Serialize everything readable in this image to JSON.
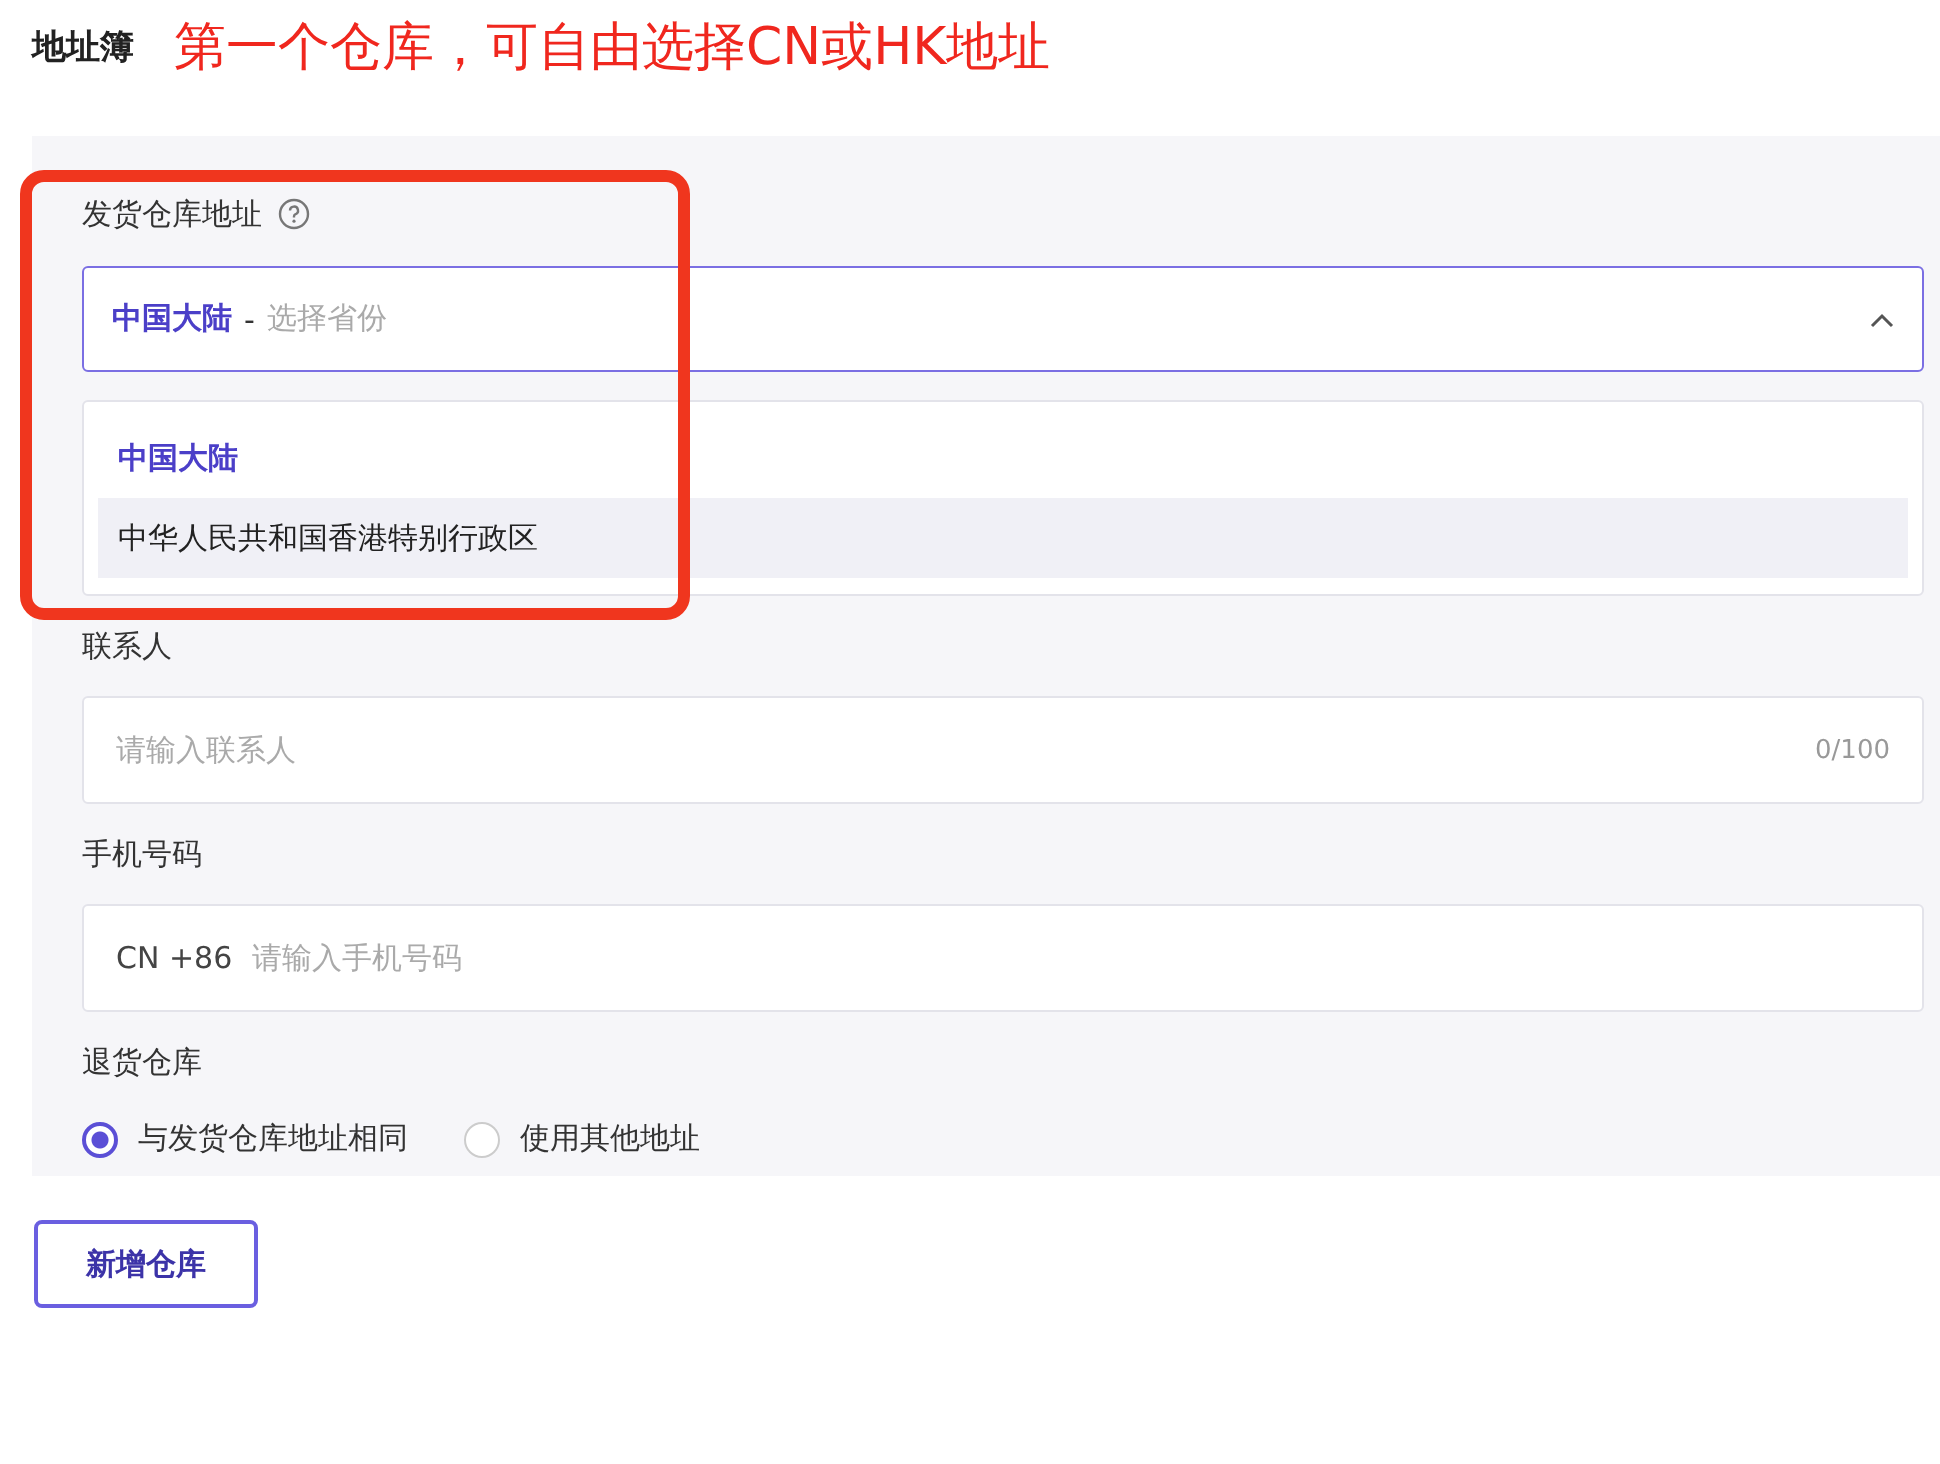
{
  "page_title": "地址簿",
  "annotation": "第一个仓库，可自由选择CN或HK地址",
  "ship_warehouse": {
    "label": "发货仓库地址",
    "select": {
      "value": "中国大陆",
      "separator": "-",
      "placeholder": "选择省份",
      "expanded": true
    },
    "options": [
      {
        "label": "中国大陆",
        "selected": true,
        "highlighted": false
      },
      {
        "label": "中华人民共和国香港特别行政区",
        "selected": false,
        "highlighted": true
      }
    ]
  },
  "contact": {
    "label": "联系人",
    "placeholder": "请输入联系人",
    "counter": "0/100"
  },
  "phone": {
    "label": "手机号码",
    "prefix": "CN +86",
    "placeholder": "请输入手机号码"
  },
  "return_warehouse": {
    "label": "退货仓库",
    "options": [
      {
        "label": "与发货仓库地址相同",
        "selected": true
      },
      {
        "label": "使用其他地址",
        "selected": false
      }
    ]
  },
  "add_button": "新增仓库"
}
